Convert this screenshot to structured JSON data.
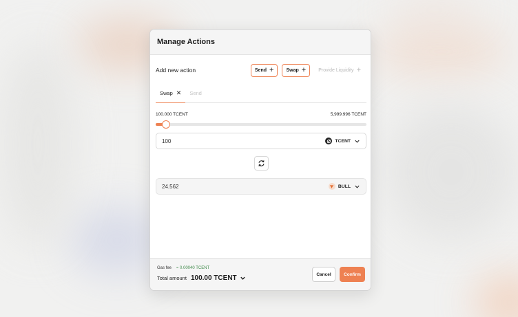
{
  "modal": {
    "title": "Manage Actions"
  },
  "add_action": {
    "label": "Add new action",
    "buttons": [
      {
        "label": "Send",
        "icon": "plus-icon"
      },
      {
        "label": "Swap",
        "icon": "plus-icon"
      },
      {
        "label": "Provide Liquidity",
        "icon": "plus-icon",
        "disabled": true
      }
    ]
  },
  "tabs": [
    {
      "label": "Swap",
      "active": true,
      "closable": true
    },
    {
      "label": "Send",
      "active": false
    }
  ],
  "range": {
    "min_label": "100.000 TCENT",
    "max_label": "5,999.996 TCENT",
    "slider_fraction": 0.03
  },
  "from_field": {
    "value": "100",
    "token": "TCENT",
    "token_icon": "tcent-logo-icon"
  },
  "switch_icon": "swap-arrows-icon",
  "to_field": {
    "value": "24.562",
    "token": "BULL",
    "token_icon": "bull-logo-icon"
  },
  "footer": {
    "gas_label": "Gas fee",
    "gas_value": "≈ 0.00040 TCENT",
    "total_label": "Total amount",
    "total_value": "100.00 TCENT",
    "cancel_label": "Cancel",
    "confirm_label": "Confirm"
  },
  "colors": {
    "accent": "#ee8152",
    "gas_green": "#3f8a4a"
  }
}
